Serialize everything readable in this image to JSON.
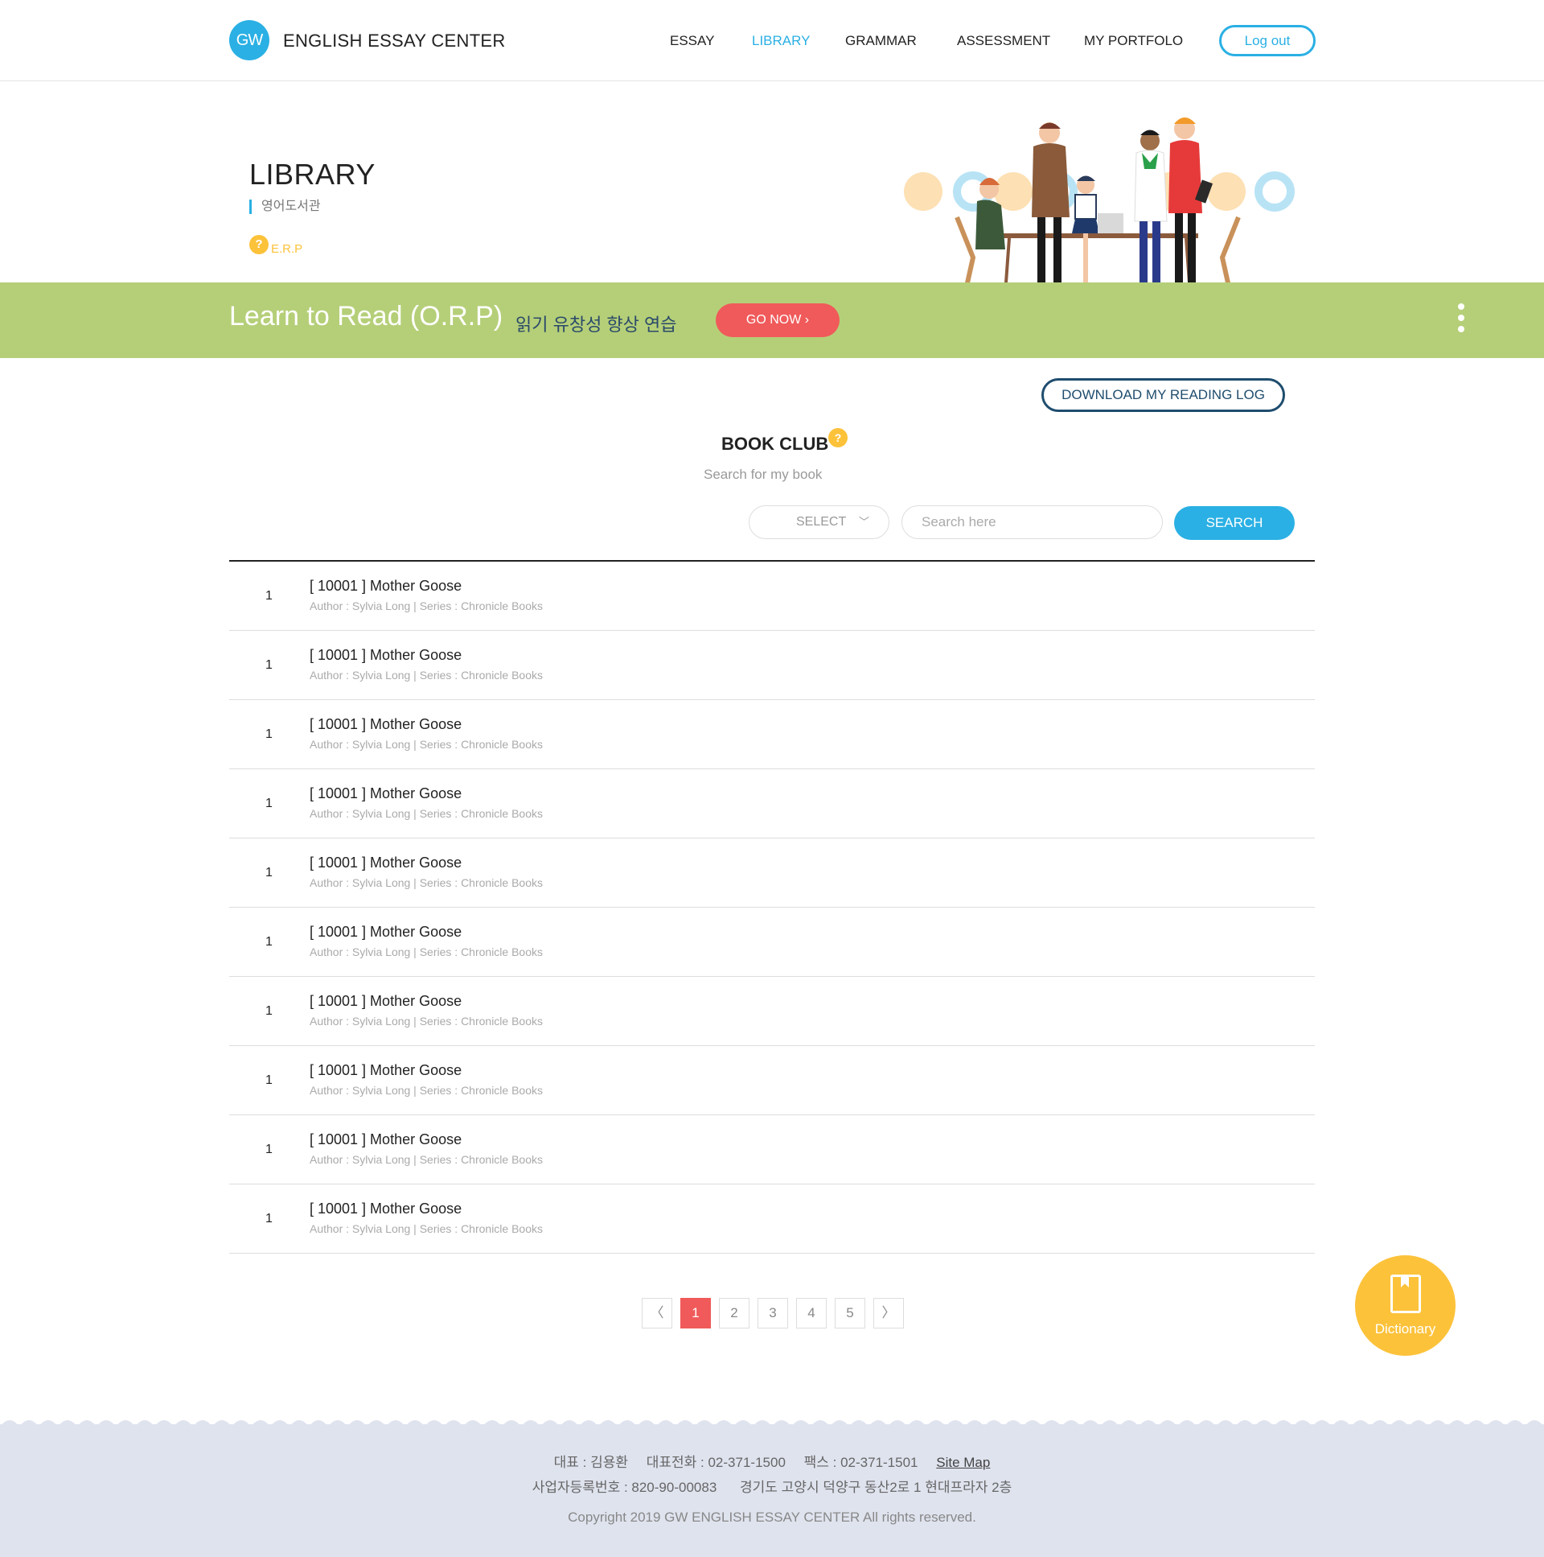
{
  "header": {
    "logo_mark": "GW",
    "brand": "ENGLISH ESSAY CENTER",
    "nav": [
      "ESSAY",
      "LIBRARY",
      "GRAMMAR",
      "ASSESSMENT",
      "MY PORTFOLO"
    ],
    "active_nav": "LIBRARY",
    "logout_label": "Log out",
    "accent_color": "#2ab0e4"
  },
  "hero": {
    "title": "LIBRARY",
    "subtitle": "영어도서관",
    "erp_icon": "?",
    "erp_label": "E.R.P"
  },
  "banner": {
    "title": "Learn to Read (O.R.P)",
    "subtitle": "읽기 유창성 향상 연습",
    "cta": "GO NOW",
    "background_color": "#b5cf78"
  },
  "book_club": {
    "download_label": "DOWNLOAD MY READING LOG",
    "title": "BOOK CLUB",
    "help_icon": "?",
    "subtitle": "Search for my book",
    "select_label": "SELECT",
    "search_placeholder": "Search here",
    "search_label": "SEARCH"
  },
  "books": [
    {
      "num": "1",
      "title": "[ 10001 ] Mother Goose",
      "meta": "Author : Sylvia Long | Series : Chronicle Books"
    },
    {
      "num": "1",
      "title": "[ 10001 ] Mother Goose",
      "meta": "Author : Sylvia Long | Series : Chronicle Books"
    },
    {
      "num": "1",
      "title": "[ 10001 ] Mother Goose",
      "meta": "Author : Sylvia Long | Series : Chronicle Books"
    },
    {
      "num": "1",
      "title": "[ 10001 ] Mother Goose",
      "meta": "Author : Sylvia Long | Series : Chronicle Books"
    },
    {
      "num": "1",
      "title": "[ 10001 ] Mother Goose",
      "meta": "Author : Sylvia Long | Series : Chronicle Books"
    },
    {
      "num": "1",
      "title": "[ 10001 ] Mother Goose",
      "meta": "Author : Sylvia Long | Series : Chronicle Books"
    },
    {
      "num": "1",
      "title": "[ 10001 ] Mother Goose",
      "meta": "Author : Sylvia Long | Series : Chronicle Books"
    },
    {
      "num": "1",
      "title": "[ 10001 ] Mother Goose",
      "meta": "Author : Sylvia Long | Series : Chronicle Books"
    },
    {
      "num": "1",
      "title": "[ 10001 ] Mother Goose",
      "meta": "Author : Sylvia Long | Series : Chronicle Books"
    },
    {
      "num": "1",
      "title": "[ 10001 ] Mother Goose",
      "meta": "Author : Sylvia Long | Series : Chronicle Books"
    }
  ],
  "pagination": {
    "prev": "〈",
    "next": "〉",
    "pages": [
      "1",
      "2",
      "3",
      "4",
      "5"
    ],
    "current": "1"
  },
  "dictionary": {
    "label": "Dictionary",
    "icon": "book-icon"
  },
  "footer": {
    "ceo": "대표 : 김용환",
    "phone": "대표전화 : 02-371-1500",
    "fax": "팩스 : 02-371-1501",
    "sitemap": "Site Map",
    "business_no": "사업자등록번호 : 820-90-00083",
    "address": "경기도 고양시 덕양구 동산2로 1 현대프라자 2층",
    "copyright": "Copyright 2019 GW ENGLISH ESSAY CENTER All rights reserved."
  }
}
